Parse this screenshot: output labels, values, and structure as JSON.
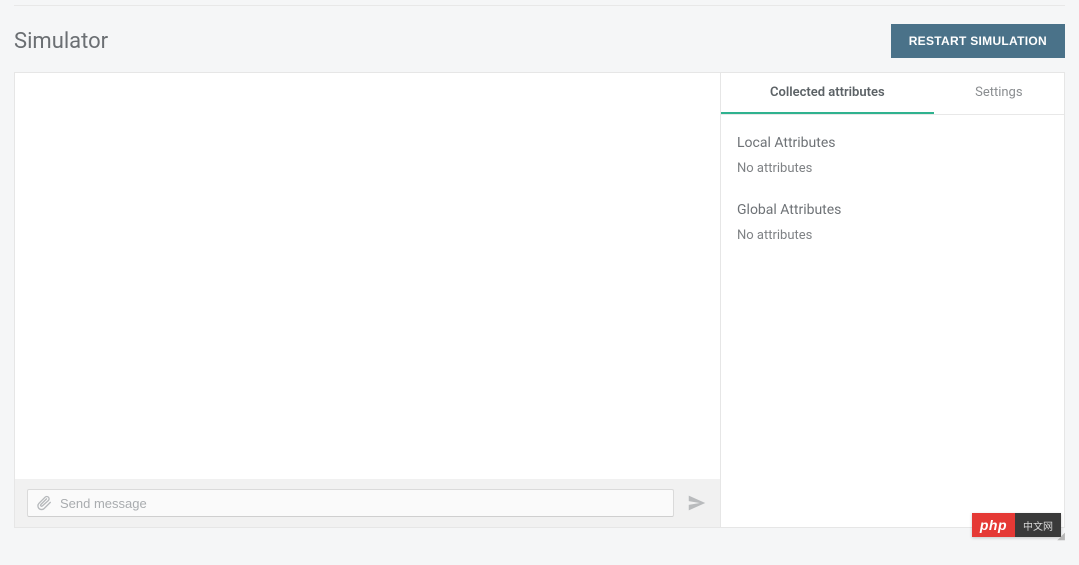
{
  "header": {
    "title": "Simulator",
    "restart_label": "RESTART SIMULATION"
  },
  "input": {
    "placeholder": "Send message"
  },
  "side": {
    "tabs": {
      "collected": "Collected attributes",
      "settings": "Settings"
    },
    "local_heading": "Local Attributes",
    "global_heading": "Global Attributes",
    "empty_text": "No attributes"
  },
  "brand": {
    "left": "php",
    "right": "中文网"
  }
}
